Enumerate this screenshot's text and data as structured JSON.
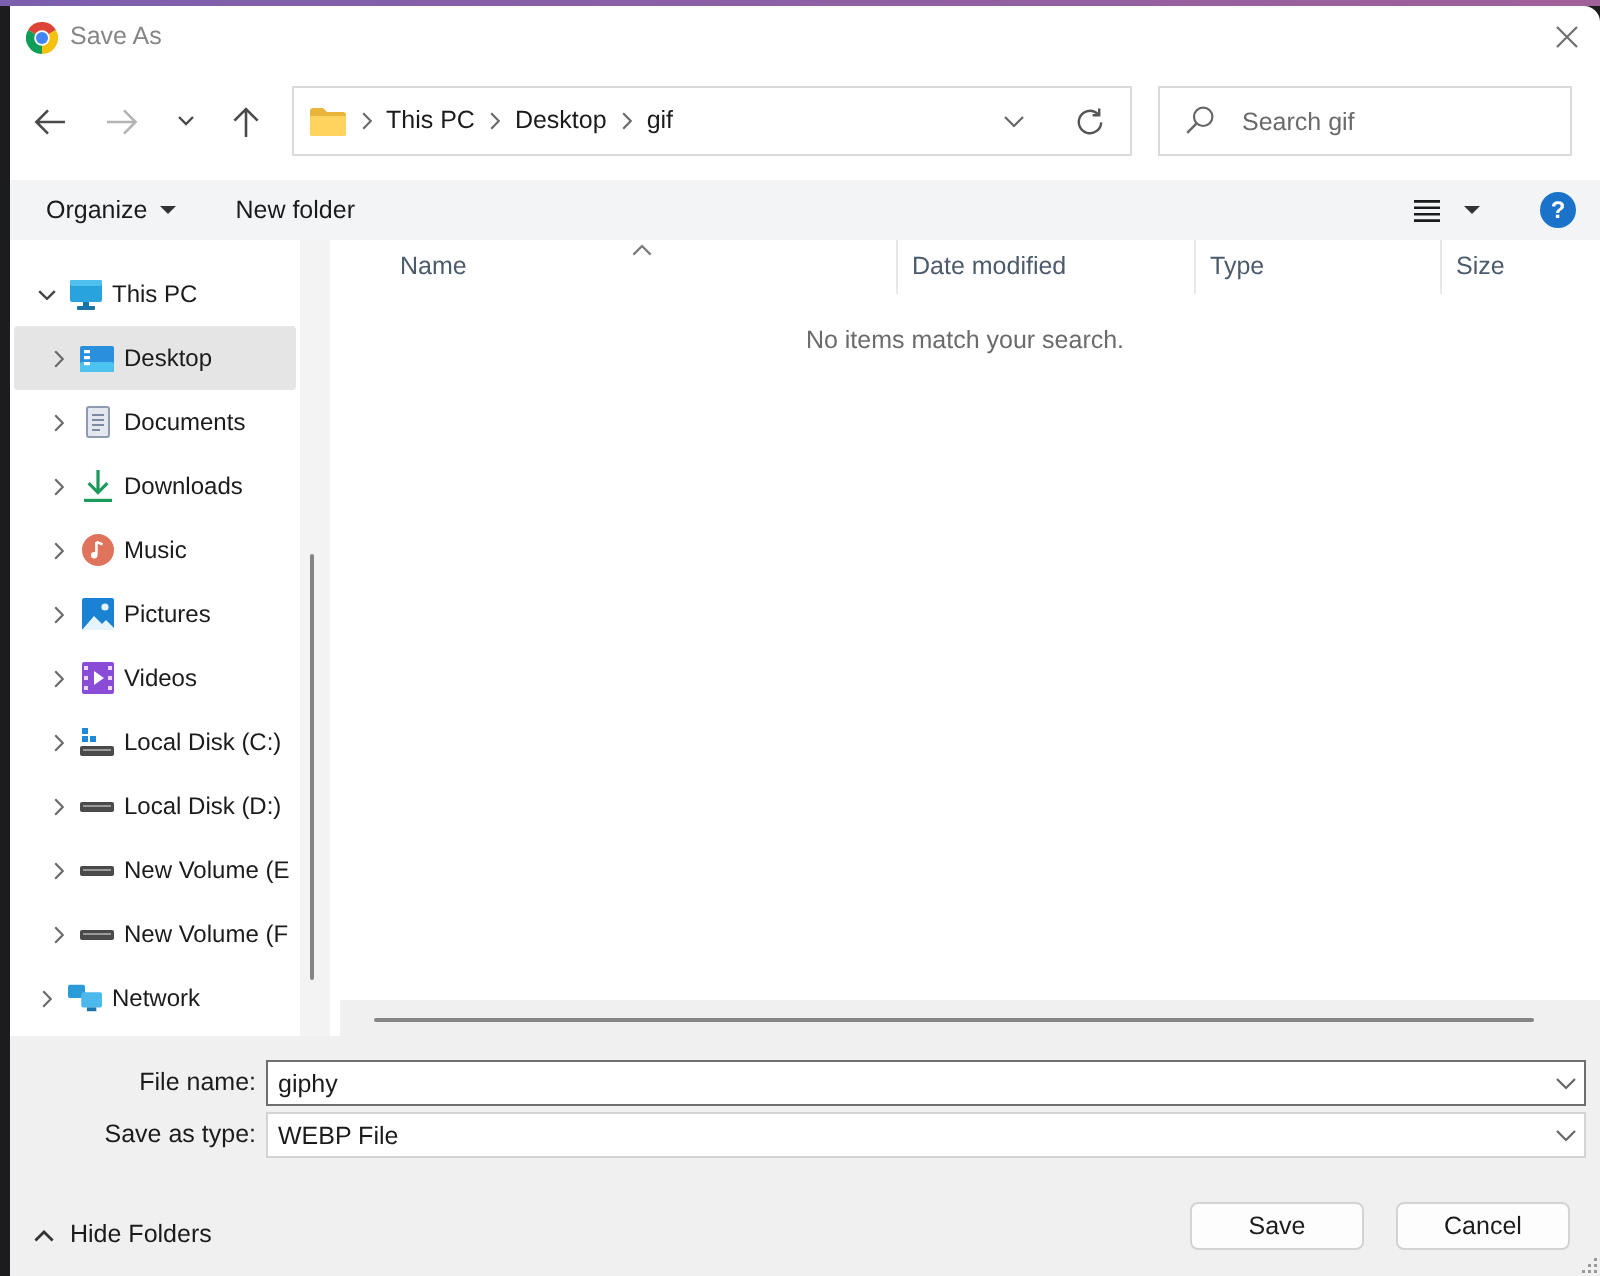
{
  "window": {
    "title": "Save As"
  },
  "navigation": {
    "buttons": [
      {
        "kind": "back",
        "disabled": false
      },
      {
        "kind": "forward",
        "disabled": true
      },
      {
        "kind": "recent",
        "disabled": false
      },
      {
        "kind": "up",
        "disabled": false
      }
    ],
    "breadcrumb": [
      {
        "label": "This PC"
      },
      {
        "label": "Desktop"
      },
      {
        "label": "gif"
      }
    ],
    "search": {
      "placeholder": "Search gif"
    }
  },
  "toolbar": {
    "buttons": [
      {
        "kind": "menu",
        "label": "Organize"
      },
      {
        "kind": "plain",
        "label": "New folder"
      }
    ],
    "help": "?"
  },
  "sidebar": {
    "items": [
      {
        "kind": "pc",
        "label": "This PC",
        "expanded": true,
        "selected": false,
        "children": [
          {
            "kind": "desktop",
            "label": "Desktop",
            "expanded": false,
            "selected": true
          },
          {
            "kind": "documents",
            "label": "Documents",
            "expanded": false,
            "selected": false
          },
          {
            "kind": "downloads",
            "label": "Downloads",
            "expanded": false,
            "selected": false
          },
          {
            "kind": "music",
            "label": "Music",
            "expanded": false,
            "selected": false
          },
          {
            "kind": "pictures",
            "label": "Pictures",
            "expanded": false,
            "selected": false
          },
          {
            "kind": "videos",
            "label": "Videos",
            "expanded": false,
            "selected": false
          },
          {
            "kind": "sysdrive",
            "label": "Local Disk (C:)",
            "expanded": false,
            "selected": false
          },
          {
            "kind": "drive",
            "label": "Local Disk (D:)",
            "expanded": false,
            "selected": false
          },
          {
            "kind": "drive",
            "label": "New Volume (E",
            "expanded": false,
            "selected": false
          },
          {
            "kind": "drive",
            "label": "New Volume (F",
            "expanded": false,
            "selected": false
          }
        ]
      },
      {
        "kind": "network",
        "label": "Network",
        "expanded": false,
        "selected": false
      }
    ]
  },
  "table": {
    "columns": [
      {
        "label": "Name",
        "sorted": true
      },
      {
        "label": "Date modified",
        "sorted": false
      },
      {
        "label": "Type",
        "sorted": false
      },
      {
        "label": "Size",
        "sorted": false
      }
    ],
    "empty_message": "No items match your search."
  },
  "footer": {
    "fields": [
      {
        "label": "File name:",
        "value": "giphy",
        "focused": true
      },
      {
        "label": "Save as type:",
        "value": "WEBP File",
        "focused": false
      }
    ],
    "hide_folders": "Hide Folders",
    "buttons": [
      {
        "label": "Save"
      },
      {
        "label": "Cancel"
      }
    ]
  }
}
